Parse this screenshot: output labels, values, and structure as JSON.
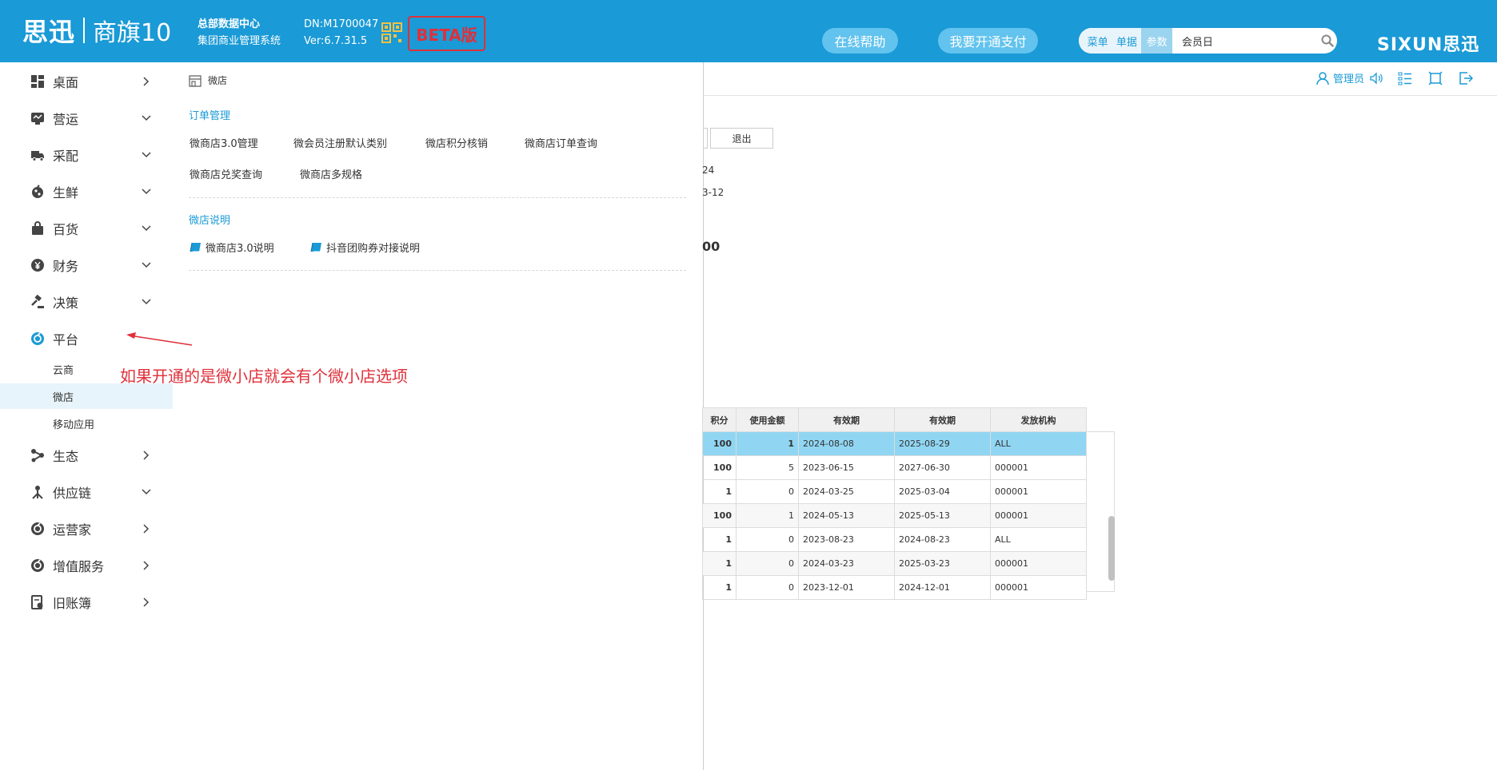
{
  "header": {
    "brand": "思迅",
    "product": "商旗10",
    "org_line1": "总部数据中心",
    "org_line2": "集团商业管理系统",
    "dn": "DN:M1700047",
    "version": "Ver:6.7.31.5",
    "beta": "BETA版",
    "help_button": "在线帮助",
    "pay_button": "我要开通支付",
    "search_tabs": [
      "菜单",
      "单据",
      "参数"
    ],
    "search_value": "会员日",
    "right_logo": "SIXUN思迅",
    "accent": "#1a9ad6"
  },
  "sidebar": {
    "items": [
      {
        "label": "桌面",
        "icon": "dashboard-icon",
        "chevron": "right"
      },
      {
        "label": "营运",
        "icon": "operation-icon",
        "chevron": "down"
      },
      {
        "label": "采配",
        "icon": "truck-icon",
        "chevron": "down"
      },
      {
        "label": "生鲜",
        "icon": "fresh-icon",
        "chevron": "down"
      },
      {
        "label": "百货",
        "icon": "bag-icon",
        "chevron": "down"
      },
      {
        "label": "财务",
        "icon": "yen-icon",
        "chevron": "down"
      },
      {
        "label": "决策",
        "icon": "gavel-icon",
        "chevron": "down"
      },
      {
        "label": "平台",
        "icon": "platform-icon",
        "chevron": ""
      },
      {
        "label": "生态",
        "icon": "eco-icon",
        "chevron": "right"
      },
      {
        "label": "供应链",
        "icon": "supply-icon",
        "chevron": "down"
      },
      {
        "label": "运营家",
        "icon": "operator-icon",
        "chevron": "right"
      },
      {
        "label": "增值服务",
        "icon": "service-icon",
        "chevron": "right"
      },
      {
        "label": "旧账簿",
        "icon": "ledger-icon",
        "chevron": "right"
      }
    ],
    "subitems": [
      "云商",
      "微店",
      "移动应用"
    ],
    "annotation": "如果开通的是微小店就会有个微小店选项"
  },
  "panel": {
    "title": "微店",
    "section1_title": "订单管理",
    "section1_links": [
      "微商店3.0管理",
      "微会员注册默认类别",
      "微店积分核销",
      "微商店订单查询",
      "微商店兑奖查询",
      "微商店多规格"
    ],
    "section2_title": "微店说明",
    "section2_links": [
      "微商店3.0说明",
      "抖音团购券对接说明"
    ]
  },
  "topbar": {
    "user": "管理员"
  },
  "background": {
    "exit_button": "退出",
    "frag1": "24",
    "frag2": "3-12",
    "frag3": "00"
  },
  "table": {
    "headers": [
      "积分",
      "使用金额",
      "有效期",
      "有效期",
      "发放机构"
    ],
    "rows": [
      [
        "100",
        "1",
        "2024-08-08",
        "2025-08-29",
        "ALL"
      ],
      [
        "100",
        "5",
        "2023-06-15",
        "2027-06-30",
        "000001"
      ],
      [
        "1",
        "0",
        "2024-03-25",
        "2025-03-04",
        "000001"
      ],
      [
        "100",
        "1",
        "2024-05-13",
        "2025-05-13",
        "000001"
      ],
      [
        "1",
        "0",
        "2023-08-23",
        "2024-08-23",
        "ALL"
      ],
      [
        "1",
        "0",
        "2024-03-23",
        "2025-03-23",
        "000001"
      ],
      [
        "1",
        "0",
        "2023-12-01",
        "2024-12-01",
        "000001"
      ]
    ]
  }
}
